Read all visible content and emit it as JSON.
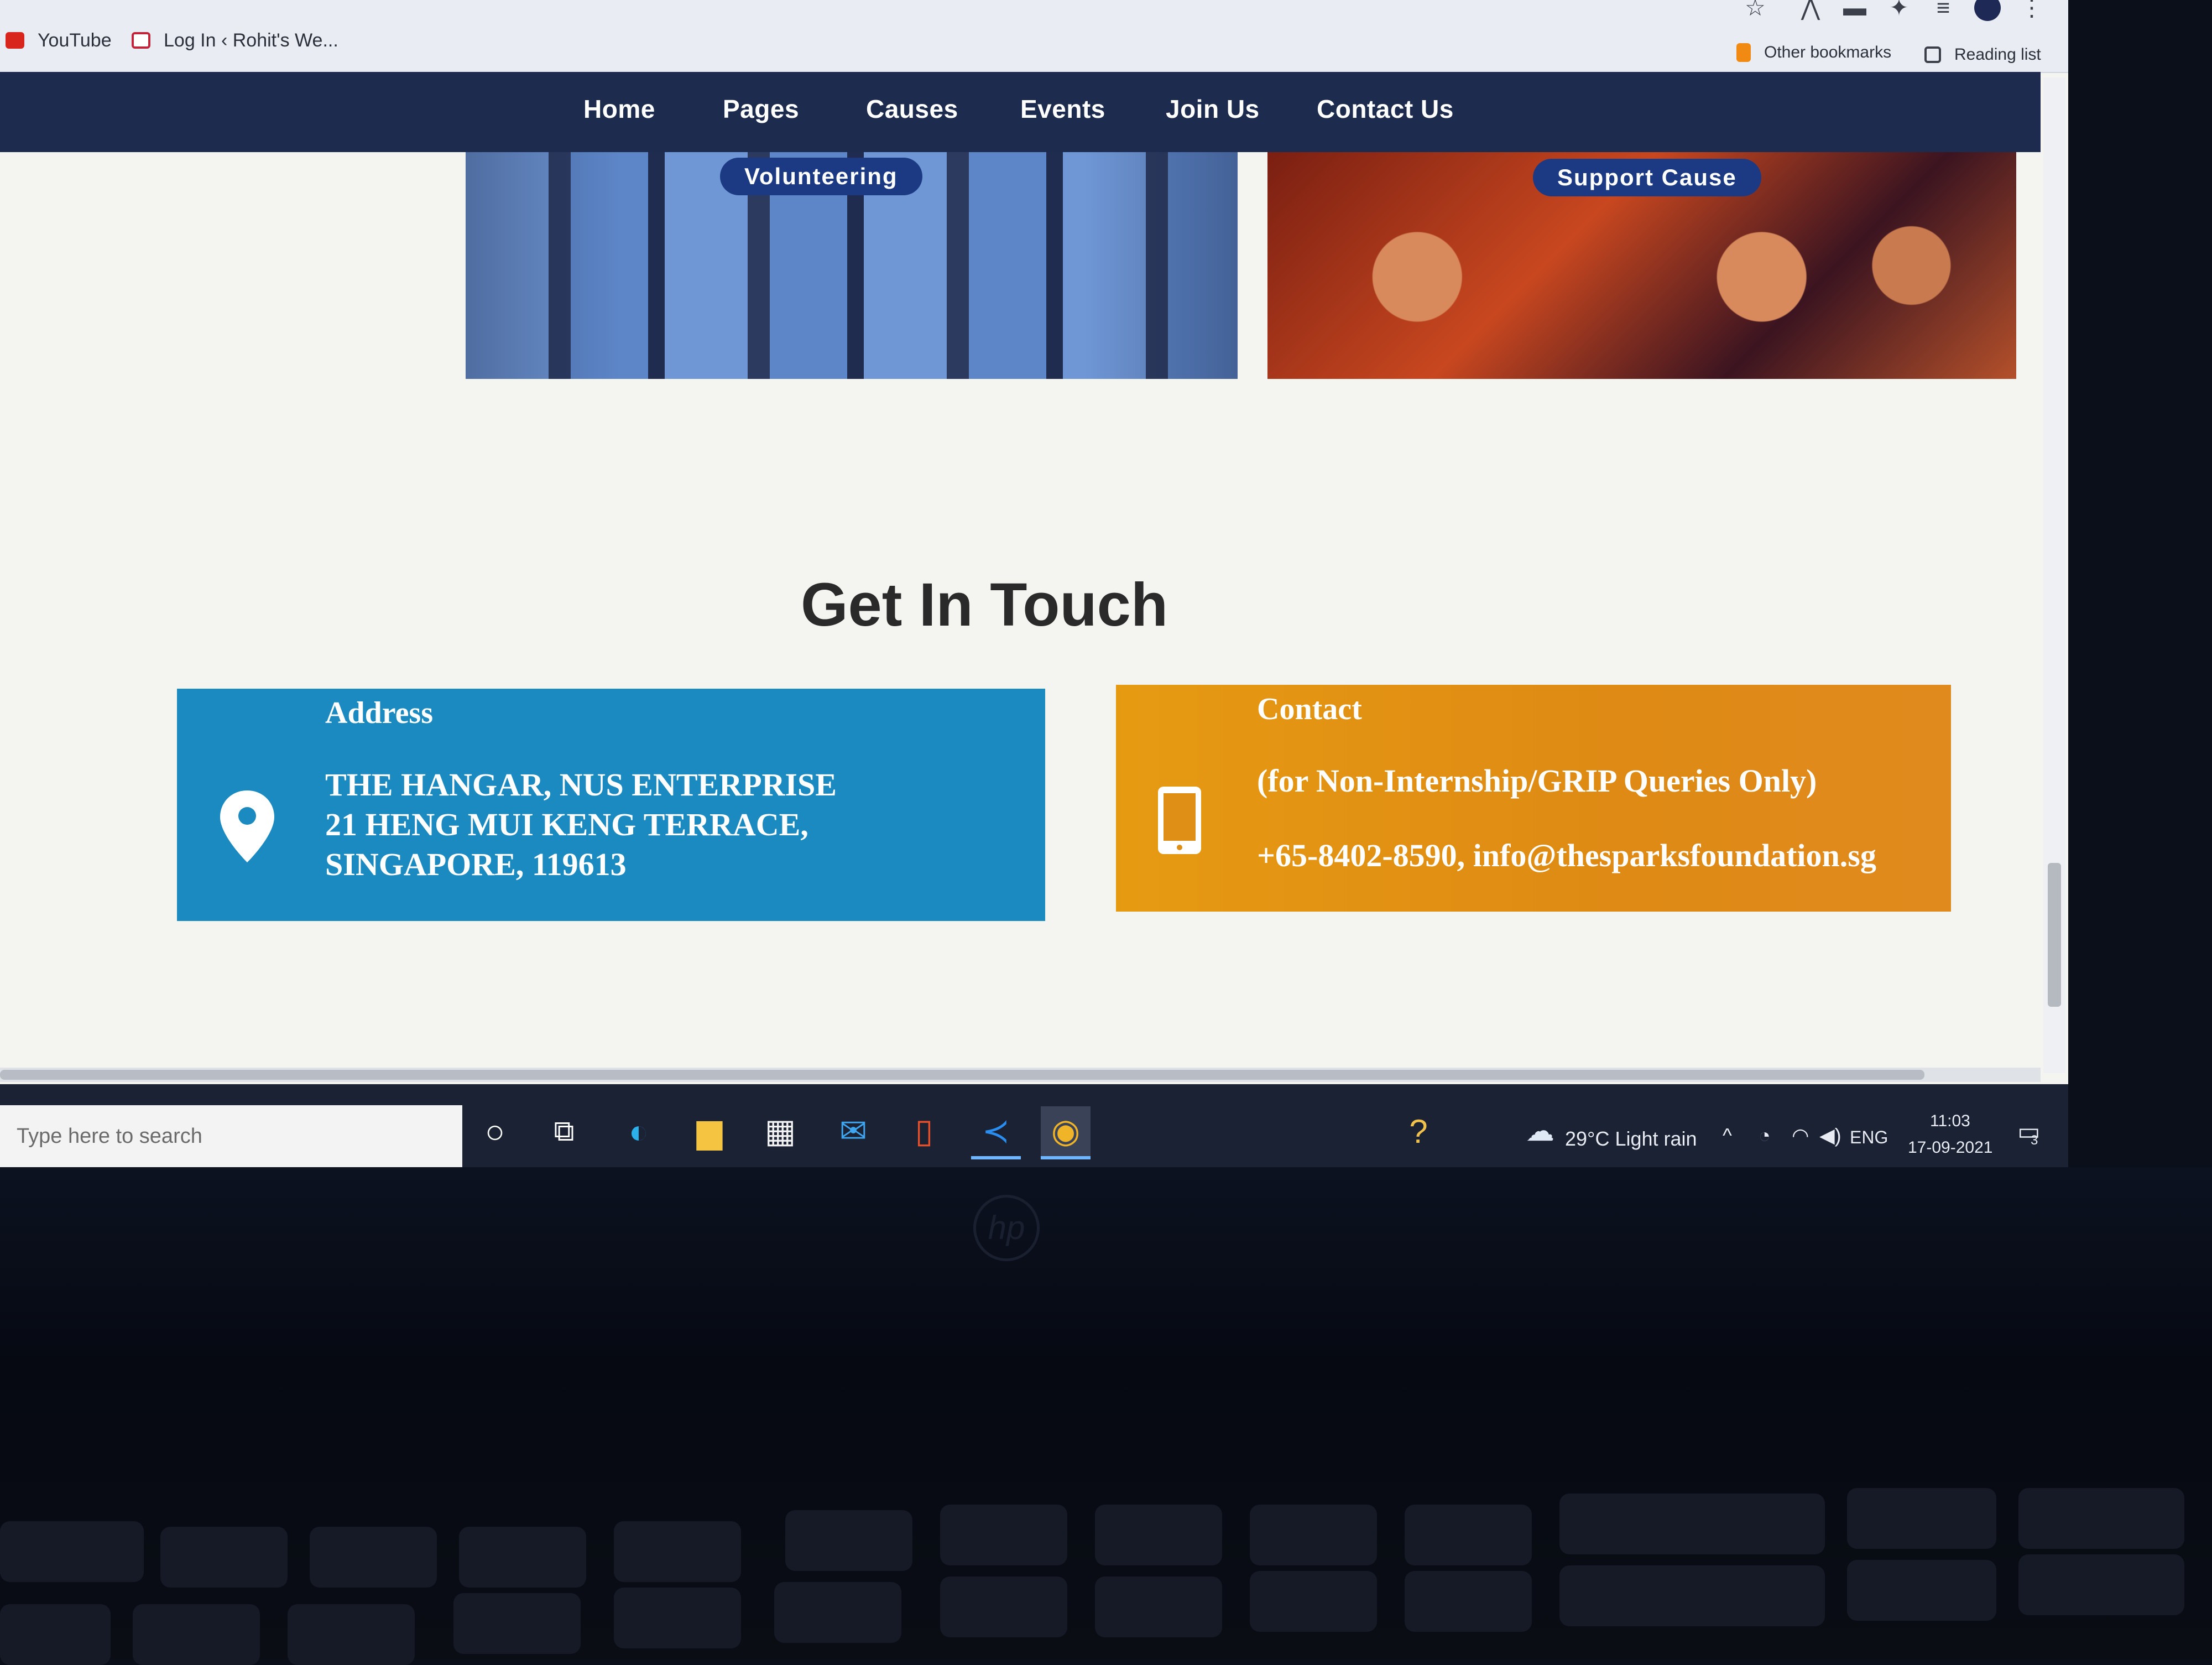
{
  "bookmarks_bar": {
    "items": [
      {
        "label": "YouTube"
      },
      {
        "label": "Log In ‹ Rohit's We..."
      },
      {
        "label": "Other bookmarks"
      },
      {
        "label": "Reading list"
      }
    ]
  },
  "nav": {
    "items": [
      "Home",
      "Pages",
      "Causes",
      "Events",
      "Join Us",
      "Contact Us"
    ]
  },
  "photos": {
    "volunteering_label": "Volunteering",
    "support_label": "Support Cause"
  },
  "section": {
    "title": "Get In Touch"
  },
  "address_card": {
    "title": "Address",
    "line1": "THE HANGAR, NUS ENTERPRISE",
    "line2": "21 HENG MUI KENG TERRACE,",
    "line3": "SINGAPORE, 119613"
  },
  "contact_card": {
    "title": "Contact",
    "note": "(for Non-Internship/GRIP Queries Only)",
    "details": "+65-8402-8590, info@thesparksfoundation.sg"
  },
  "taskbar": {
    "search_placeholder": "Type here to search",
    "weather": "29°C  Light rain",
    "language": "ENG",
    "time": "11:03",
    "date": "17-09-2021",
    "notifications": "3"
  },
  "colors": {
    "nav_bg": "#1d2b4e",
    "address_card": "#1b8ac0",
    "contact_card": "#e69a12",
    "label_pill": "#1c3a83"
  }
}
